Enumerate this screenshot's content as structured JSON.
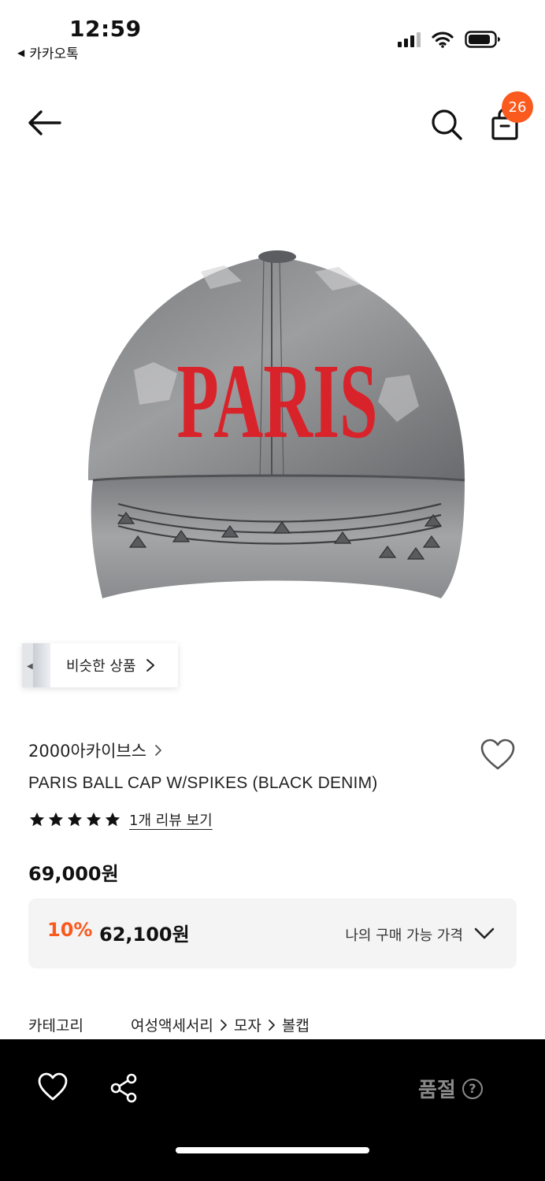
{
  "status_bar": {
    "time": "12:59",
    "back_app": "카카오톡"
  },
  "header": {
    "cart_count": "26"
  },
  "product": {
    "image_text": "PARIS",
    "similar_label": "비슷한 상품",
    "brand": "2000아카이브스",
    "name": "PARIS BALL CAP W/SPIKES (BLACK DENIM)",
    "rating_stars": 5,
    "review_link": "1개 리뷰 보기",
    "original_price": "69,000원",
    "discount": "10%",
    "sale_price": "62,100원",
    "my_price_label": "나의 구매 가능 가격"
  },
  "category": {
    "label": "카테고리",
    "path": [
      "여성액세서리",
      "모자",
      "볼캡"
    ]
  },
  "bottom_bar": {
    "status_label": "품절",
    "help_glyph": "?"
  },
  "colors": {
    "accent": "#fa5a1e",
    "bottom_bar_bg": "#000000",
    "price_box_bg": "#f4f4f5",
    "soldout_text": "#8a8a8a"
  }
}
